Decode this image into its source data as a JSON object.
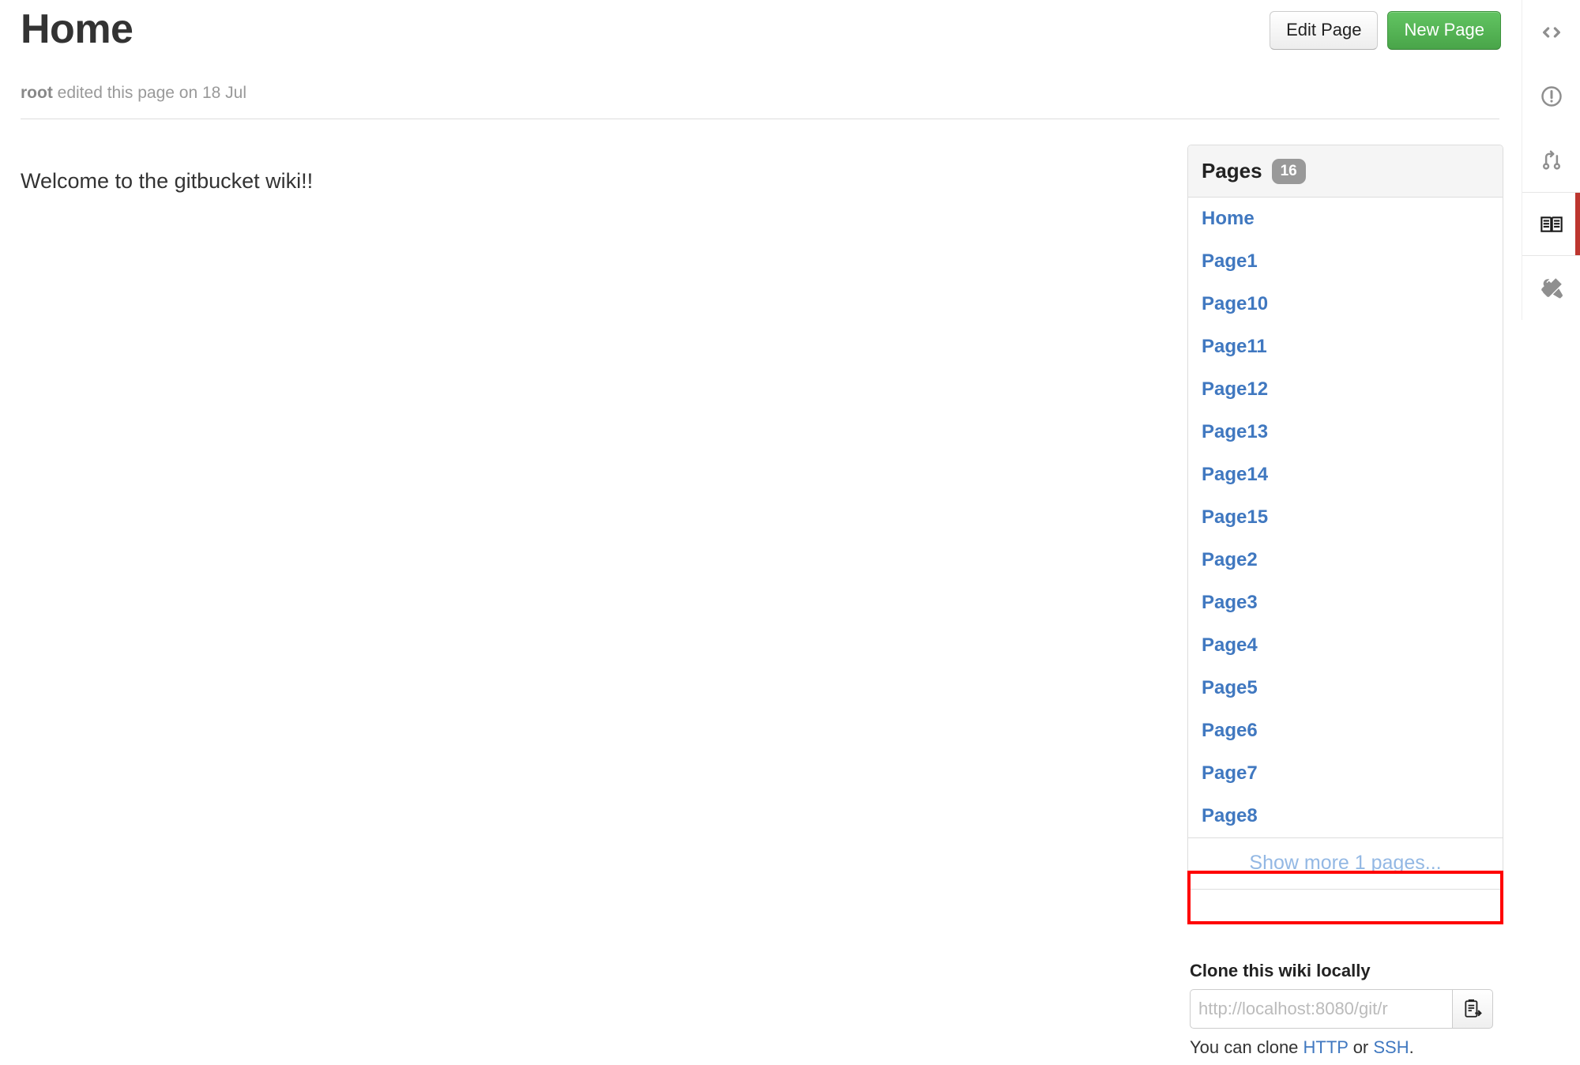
{
  "header": {
    "title": "Home",
    "byline_author": "root",
    "byline_text": " edited this page on 18 Jul",
    "edit_button_label": "Edit Page",
    "new_button_label": "New Page"
  },
  "content": {
    "welcome_text": "Welcome to the gitbucket wiki!!"
  },
  "pages_panel": {
    "title": "Pages",
    "count_badge": "16",
    "items": [
      {
        "label": "Home"
      },
      {
        "label": "Page1"
      },
      {
        "label": "Page10"
      },
      {
        "label": "Page11"
      },
      {
        "label": "Page12"
      },
      {
        "label": "Page13"
      },
      {
        "label": "Page14"
      },
      {
        "label": "Page15"
      },
      {
        "label": "Page2"
      },
      {
        "label": "Page3"
      },
      {
        "label": "Page4"
      },
      {
        "label": "Page5"
      },
      {
        "label": "Page6"
      },
      {
        "label": "Page7"
      },
      {
        "label": "Page8"
      }
    ],
    "show_more_label": "Show more 1 pages...",
    "annotation_color": "#ff0000"
  },
  "clone": {
    "label": "Clone this wiki locally",
    "url_value": "http://localhost:8080/git/r",
    "copy_icon": "clipboard-copy-icon",
    "hint_prefix": "You can clone ",
    "hint_http": "HTTP",
    "hint_middle": " or ",
    "hint_ssh": "SSH",
    "hint_suffix": "."
  },
  "icon_rail": {
    "items": [
      {
        "name": "code-icon",
        "active": false
      },
      {
        "name": "issues-icon",
        "active": false
      },
      {
        "name": "pull-request-icon",
        "active": false
      },
      {
        "name": "wiki-book-icon",
        "active": true
      },
      {
        "name": "settings-tools-icon",
        "active": false
      }
    ],
    "active_indicator_color": "#bd362f"
  },
  "colors": {
    "link": "#4078c0",
    "success_button": "#49a549",
    "badge": "#999999",
    "muted_text": "#999999"
  }
}
